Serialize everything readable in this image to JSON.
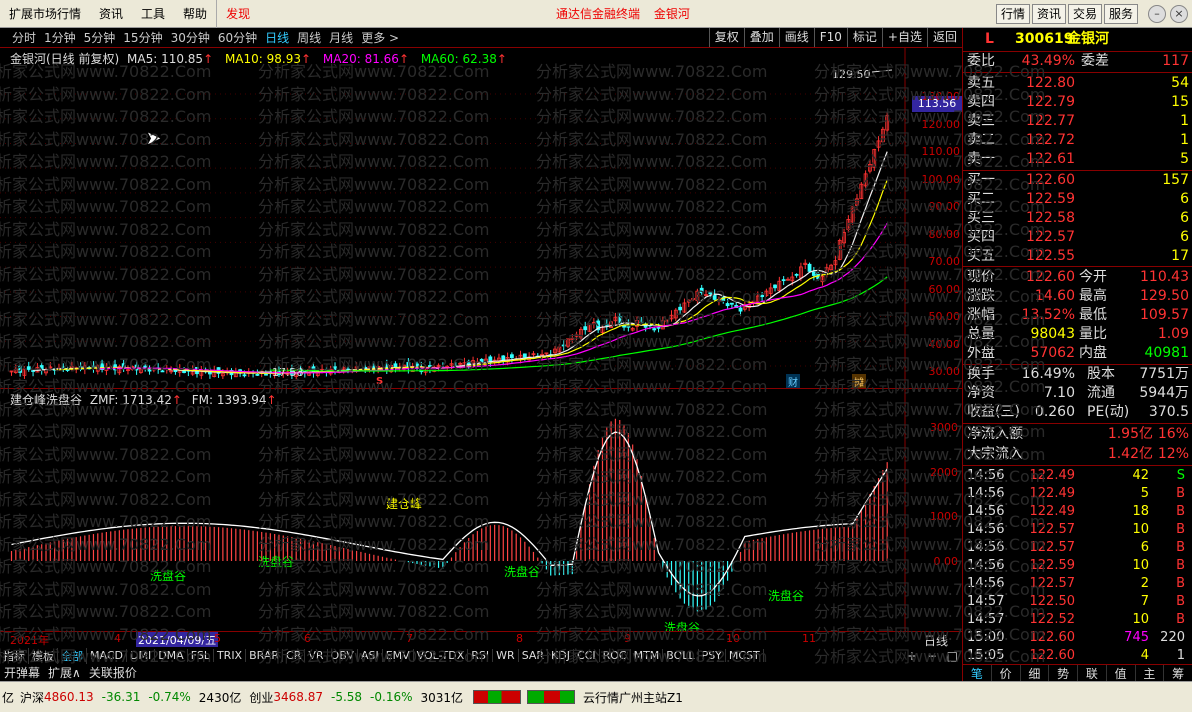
{
  "menu": {
    "items": [
      "扩展市场行情",
      "资讯",
      "工具",
      "帮助",
      "发现"
    ],
    "center": "通达信金融终端  金银河",
    "right": [
      "行情",
      "资讯",
      "交易",
      "服务"
    ]
  },
  "periods": [
    "分时",
    "1分钟",
    "5分钟",
    "15分钟",
    "30分钟",
    "60分钟",
    "日线",
    "周线",
    "月线",
    "更多 >"
  ],
  "toolbtns": [
    "复权",
    "叠加",
    "画线",
    "F10",
    "标记",
    "+自选",
    "返回"
  ],
  "legend": {
    "name": "金银河(日线 前复权)",
    "ma5": "MA5: 110.85",
    "ma10": "MA10: 98.93",
    "ma20": "MA20: 81.66",
    "ma60": "MA60: 62.38"
  },
  "sublegend": {
    "name": "建仓峰洗盘谷",
    "zmf": "ZMF: 1713.42",
    "fm": "FM: 1393.94"
  },
  "annotations": {
    "high": "129.50",
    "low": "17.58",
    "price_tag": "113.56",
    "s_mark": "S",
    "cai": "财",
    "tuo": "摊",
    "jcf": "建仓峰",
    "xpg": "洗盘谷"
  },
  "main_axis": [
    "130.00",
    "120.00",
    "110.00",
    "100.00",
    "90.00",
    "80.00",
    "70.00",
    "60.00",
    "50.00",
    "40.00",
    "30.00",
    "20.00"
  ],
  "sub_axis": [
    "3000",
    "2000",
    "1000",
    "0.00"
  ],
  "date_axis": {
    "year": "2021年",
    "months": [
      "4",
      "5",
      "6",
      "7",
      "8",
      "9",
      "10",
      "11"
    ],
    "cursor": "2021/04/09/五",
    "period": "日线"
  },
  "indicators": [
    "指标",
    "模板",
    "全部",
    "MACD",
    "DMI",
    "DMA",
    "FSL",
    "TRIX",
    "BRAR",
    "CR",
    "VR",
    "OBV",
    "ASI",
    "EMV",
    "VOL-TDX",
    "RSI",
    "WR",
    "SAR",
    "KDJ",
    "CCI",
    "ROC",
    "MTM",
    "BOLL",
    "PSY",
    "MCST"
  ],
  "row2": [
    "开弹幕",
    "扩展∧",
    "关联报价"
  ],
  "status": {
    "sh_label": "沪深",
    "sh_val": "4860.13",
    "sh_chg": "-36.31",
    "sh_pct": "-0.74%",
    "sh_amt": "2430亿",
    "cy_label": "创业",
    "cy_val": "3468.87",
    "cy_chg": "-5.58",
    "cy_pct": "-0.16%",
    "cy_amt": "3031亿",
    "server": "云行情广州主站Z1"
  },
  "quote": {
    "flag": "L",
    "code": "300619",
    "name": "金银河",
    "weibi": {
      "label": "委比",
      "val": "43.49%",
      "label2": "委差",
      "val2": "117"
    },
    "sells": [
      {
        "l": "卖五",
        "p": "122.80",
        "v": "54"
      },
      {
        "l": "卖四",
        "p": "122.79",
        "v": "15"
      },
      {
        "l": "卖三",
        "p": "122.77",
        "v": "1"
      },
      {
        "l": "卖二",
        "p": "122.72",
        "v": "1"
      },
      {
        "l": "卖一",
        "p": "122.61",
        "v": "5"
      }
    ],
    "buys": [
      {
        "l": "买一",
        "p": "122.60",
        "v": "157"
      },
      {
        "l": "买二",
        "p": "122.59",
        "v": "6"
      },
      {
        "l": "买三",
        "p": "122.58",
        "v": "6"
      },
      {
        "l": "买四",
        "p": "122.57",
        "v": "6"
      },
      {
        "l": "买五",
        "p": "122.55",
        "v": "17"
      }
    ],
    "stats": [
      {
        "l": "现价",
        "v": "122.60",
        "l2": "今开",
        "v2": "110.43"
      },
      {
        "l": "涨跌",
        "v": "14.60",
        "l2": "最高",
        "v2": "129.50"
      },
      {
        "l": "涨幅",
        "v": "13.52%",
        "l2": "最低",
        "v2": "109.57"
      },
      {
        "l": "总量",
        "v": "98043",
        "l2": "量比",
        "v2": "1.09"
      },
      {
        "l": "外盘",
        "v": "57062",
        "l2": "内盘",
        "v2": "40981"
      }
    ],
    "stats2": [
      {
        "l": "换手",
        "v": "16.49%",
        "l2": "股本",
        "v2": "7751万"
      },
      {
        "l": "净资",
        "v": "7.10",
        "l2": "流通",
        "v2": "5944万"
      },
      {
        "l": "收益(三)",
        "v": "0.260",
        "l2": "PE(动)",
        "v2": "370.5"
      }
    ],
    "flows": [
      {
        "l": "净流入额",
        "v": "1.95亿",
        "p": "16%"
      },
      {
        "l": "大宗流入",
        "v": "1.42亿",
        "p": "12%"
      }
    ],
    "ticks": [
      {
        "t": "14:56",
        "p": "122.49",
        "v": "42",
        "s": "S"
      },
      {
        "t": "14:56",
        "p": "122.49",
        "v": "5",
        "s": "B"
      },
      {
        "t": "14:56",
        "p": "122.49",
        "v": "18",
        "s": "B"
      },
      {
        "t": "14:56",
        "p": "122.57",
        "v": "10",
        "s": "B"
      },
      {
        "t": "14:56",
        "p": "122.57",
        "v": "6",
        "s": "B"
      },
      {
        "t": "14:56",
        "p": "122.59",
        "v": "10",
        "s": "B"
      },
      {
        "t": "14:56",
        "p": "122.57",
        "v": "2",
        "s": "B"
      },
      {
        "t": "14:57",
        "p": "122.50",
        "v": "7",
        "s": "B"
      },
      {
        "t": "14:57",
        "p": "122.52",
        "v": "10",
        "s": "B"
      },
      {
        "t": "15:00",
        "p": "122.60",
        "v": "745",
        "s": "220"
      },
      {
        "t": "15:05",
        "p": "122.60",
        "v": "4",
        "s": "1"
      }
    ],
    "bottom_tabs": [
      "笔",
      "价",
      "细",
      "势",
      "联",
      "值",
      "主",
      "筹"
    ]
  },
  "watermark": "分析家公式网www.70822.Com"
}
